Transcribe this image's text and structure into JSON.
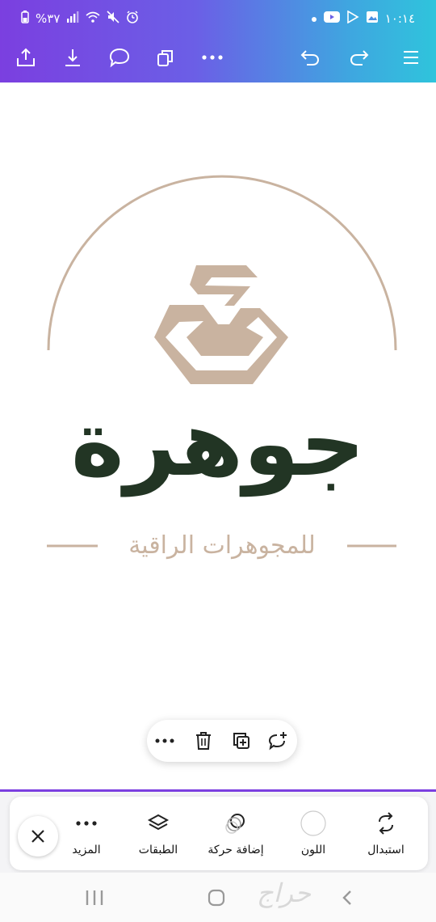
{
  "status_bar": {
    "battery": "%٣٧",
    "time": "١٠:١٤",
    "icons": [
      "battery-icon",
      "signal-icon",
      "wifi-icon",
      "mute-icon",
      "alarm-icon",
      "dot-icon",
      "youtube-icon",
      "play-store-icon",
      "gallery-icon"
    ]
  },
  "toolbar": {
    "icons": [
      "share-icon",
      "download-icon",
      "comment-icon",
      "copy-pages-icon",
      "more-icon",
      "undo-icon",
      "redo-icon",
      "menu-icon"
    ]
  },
  "logo": {
    "brand_name": "جوهرة",
    "tagline": "للمجوهرات الراقية",
    "colors": {
      "gold": "#c9b3a0",
      "green": "#223524"
    }
  },
  "context_menu": {
    "icons": [
      "more-icon",
      "delete-icon",
      "duplicate-icon",
      "comment-add-icon"
    ]
  },
  "bottom_tools": {
    "close_icon": "close-icon",
    "items": [
      {
        "label": "المزيد",
        "icon": "more-icon"
      },
      {
        "label": "الطبقات",
        "icon": "layers-icon"
      },
      {
        "label": "إضافة حركة",
        "icon": "animate-icon"
      },
      {
        "label": "اللون",
        "icon": "color-swatch-icon"
      },
      {
        "label": "استبدال",
        "icon": "replace-icon"
      }
    ]
  },
  "nav_bar": {
    "icons": [
      "recent-apps-icon",
      "home-icon",
      "back-icon"
    ],
    "watermark": "حراج"
  },
  "accent": "#7b3fe0"
}
